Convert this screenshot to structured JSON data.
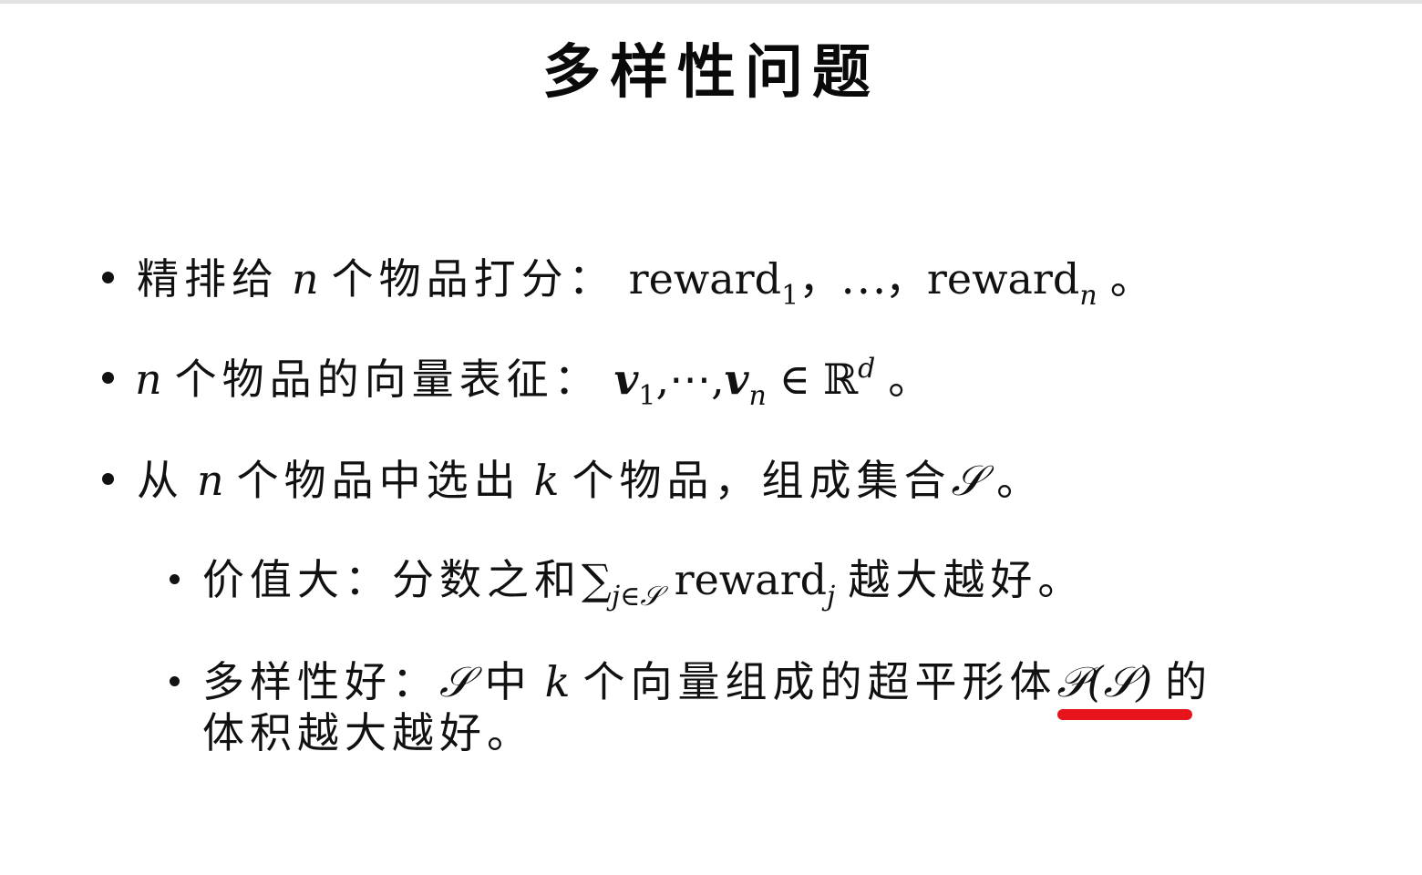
{
  "title": "多样性问题",
  "bullet1": {
    "lead": "精排给",
    "var_n": "n",
    "mid": "个物品打分：",
    "reward1": "reward",
    "sub1": "1",
    "sep": "，⋯，",
    "rewardn": "reward",
    "subn": "n",
    "end": "。"
  },
  "bullet2": {
    "var_n": "n",
    "mid": "个物品的向量表征：",
    "v1": "v",
    "sub1": "1",
    "sep": ",⋯,",
    "vn": "v",
    "subn": "n",
    "in": "∈",
    "R": "ℝ",
    "supd": "d",
    "end": "。"
  },
  "bullet3": {
    "lead": "从",
    "var_n": "n",
    "mid1": "个物品中选出",
    "var_k": "k",
    "mid2": "个物品，组成集合",
    "set": "𝒮",
    "end": "。"
  },
  "sub1": {
    "lead": "价值大：分数之和",
    "sum": "∑",
    "sum_sub": "j∈𝒮",
    "reward": "reward",
    "reward_sub": "j",
    "end": "越大越好。"
  },
  "sub2": {
    "lead": "多样性好：",
    "set": "𝒮",
    "mid1": "中",
    "var_k": "k",
    "mid2": "个向量组成的超平形体",
    "expr": "𝒫(𝒮)",
    "mid3": "的",
    "line2": "体积越大越好。"
  },
  "colors": {
    "underline": "#e8141b",
    "text": "#111111"
  }
}
